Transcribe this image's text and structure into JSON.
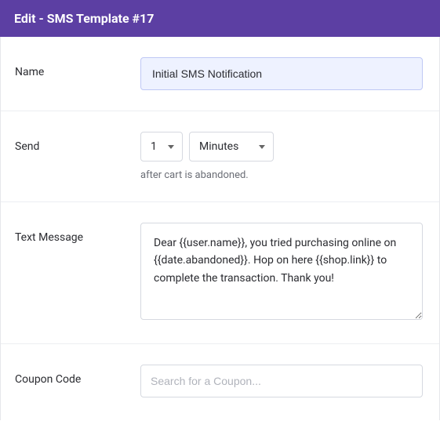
{
  "header": {
    "title": "Edit - SMS Template #17"
  },
  "form": {
    "name": {
      "label": "Name",
      "value": "Initial SMS Notification"
    },
    "send": {
      "label": "Send",
      "delay_value": "1",
      "delay_unit": "Minutes",
      "hint": "after cart is abandoned."
    },
    "message": {
      "label": "Text Message",
      "value": "Dear {{user.name}}, you tried purchasing online on {{date.abandoned}}. Hop on here {{shop.link}} to complete the transaction. Thank you!"
    },
    "coupon": {
      "label": "Coupon Code",
      "placeholder": "Search for a Coupon..."
    }
  }
}
